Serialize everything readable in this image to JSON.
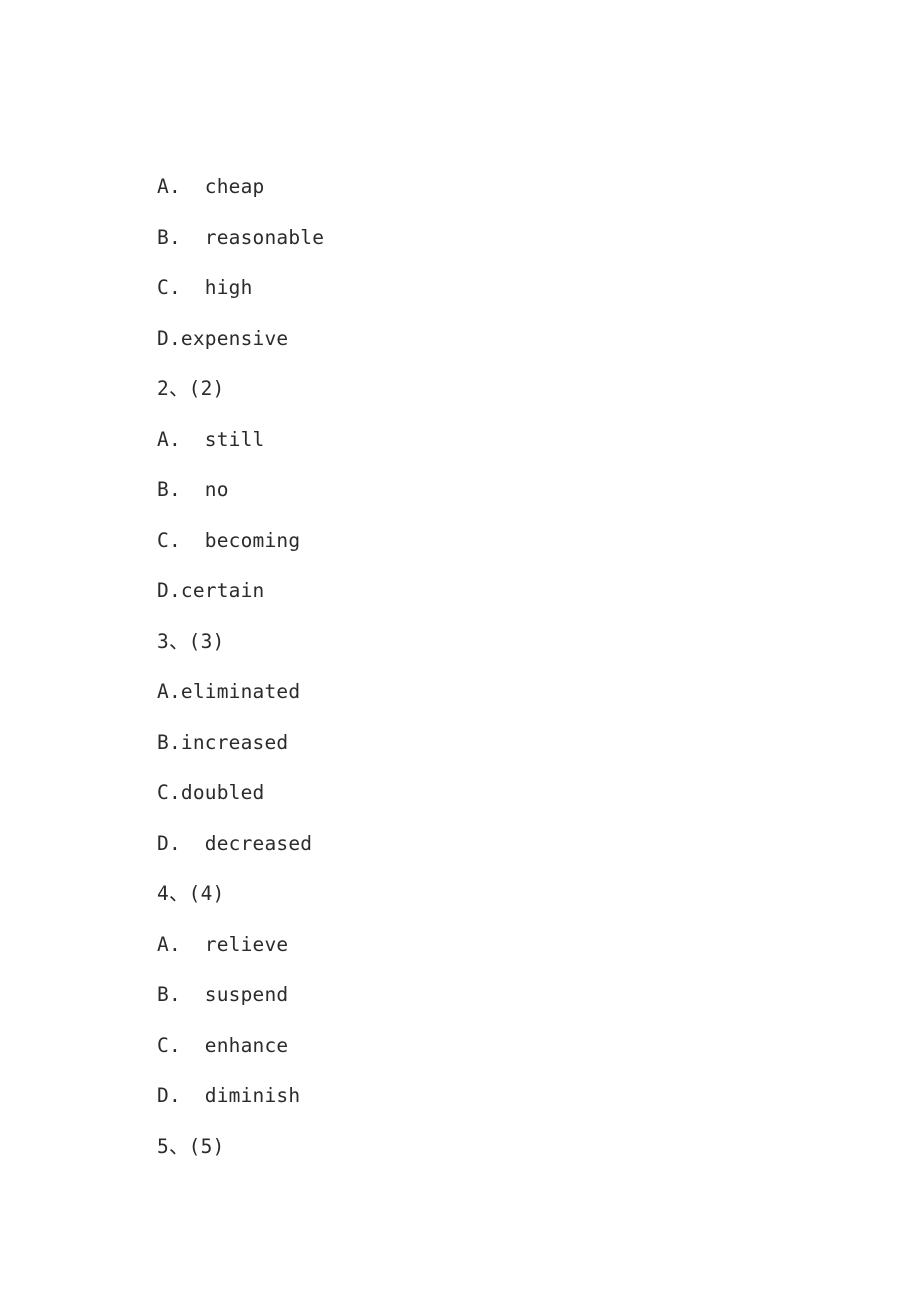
{
  "document": {
    "page_background": "#ffffff",
    "text_color": "#2b2b2b",
    "lines": [
      {
        "id": "q1-option-a",
        "kind": "option",
        "text": "A.  cheap"
      },
      {
        "id": "q1-option-b",
        "kind": "option",
        "text": "B.  reasonable"
      },
      {
        "id": "q1-option-c",
        "kind": "option",
        "text": "C.  high"
      },
      {
        "id": "q1-option-d",
        "kind": "option",
        "text": "D.expensive"
      },
      {
        "id": "q2-heading",
        "kind": "question",
        "text": "2、(2)"
      },
      {
        "id": "q2-option-a",
        "kind": "option",
        "text": "A.  still"
      },
      {
        "id": "q2-option-b",
        "kind": "option",
        "text": "B.  no"
      },
      {
        "id": "q2-option-c",
        "kind": "option",
        "text": "C.  becoming"
      },
      {
        "id": "q2-option-d",
        "kind": "option",
        "text": "D.certain"
      },
      {
        "id": "q3-heading",
        "kind": "question",
        "text": "3、(3)"
      },
      {
        "id": "q3-option-a",
        "kind": "option",
        "text": "A.eliminated"
      },
      {
        "id": "q3-option-b",
        "kind": "option",
        "text": "B.increased"
      },
      {
        "id": "q3-option-c",
        "kind": "option",
        "text": "C.doubled"
      },
      {
        "id": "q3-option-d",
        "kind": "option",
        "text": "D.  decreased"
      },
      {
        "id": "q4-heading",
        "kind": "question",
        "text": "4、(4)"
      },
      {
        "id": "q4-option-a",
        "kind": "option",
        "text": "A.  relieve"
      },
      {
        "id": "q4-option-b",
        "kind": "option",
        "text": "B.  suspend"
      },
      {
        "id": "q4-option-c",
        "kind": "option",
        "text": "C.  enhance"
      },
      {
        "id": "q4-option-d",
        "kind": "option",
        "text": "D.  diminish"
      },
      {
        "id": "q5-heading",
        "kind": "question",
        "text": "5、(5)"
      }
    ]
  }
}
